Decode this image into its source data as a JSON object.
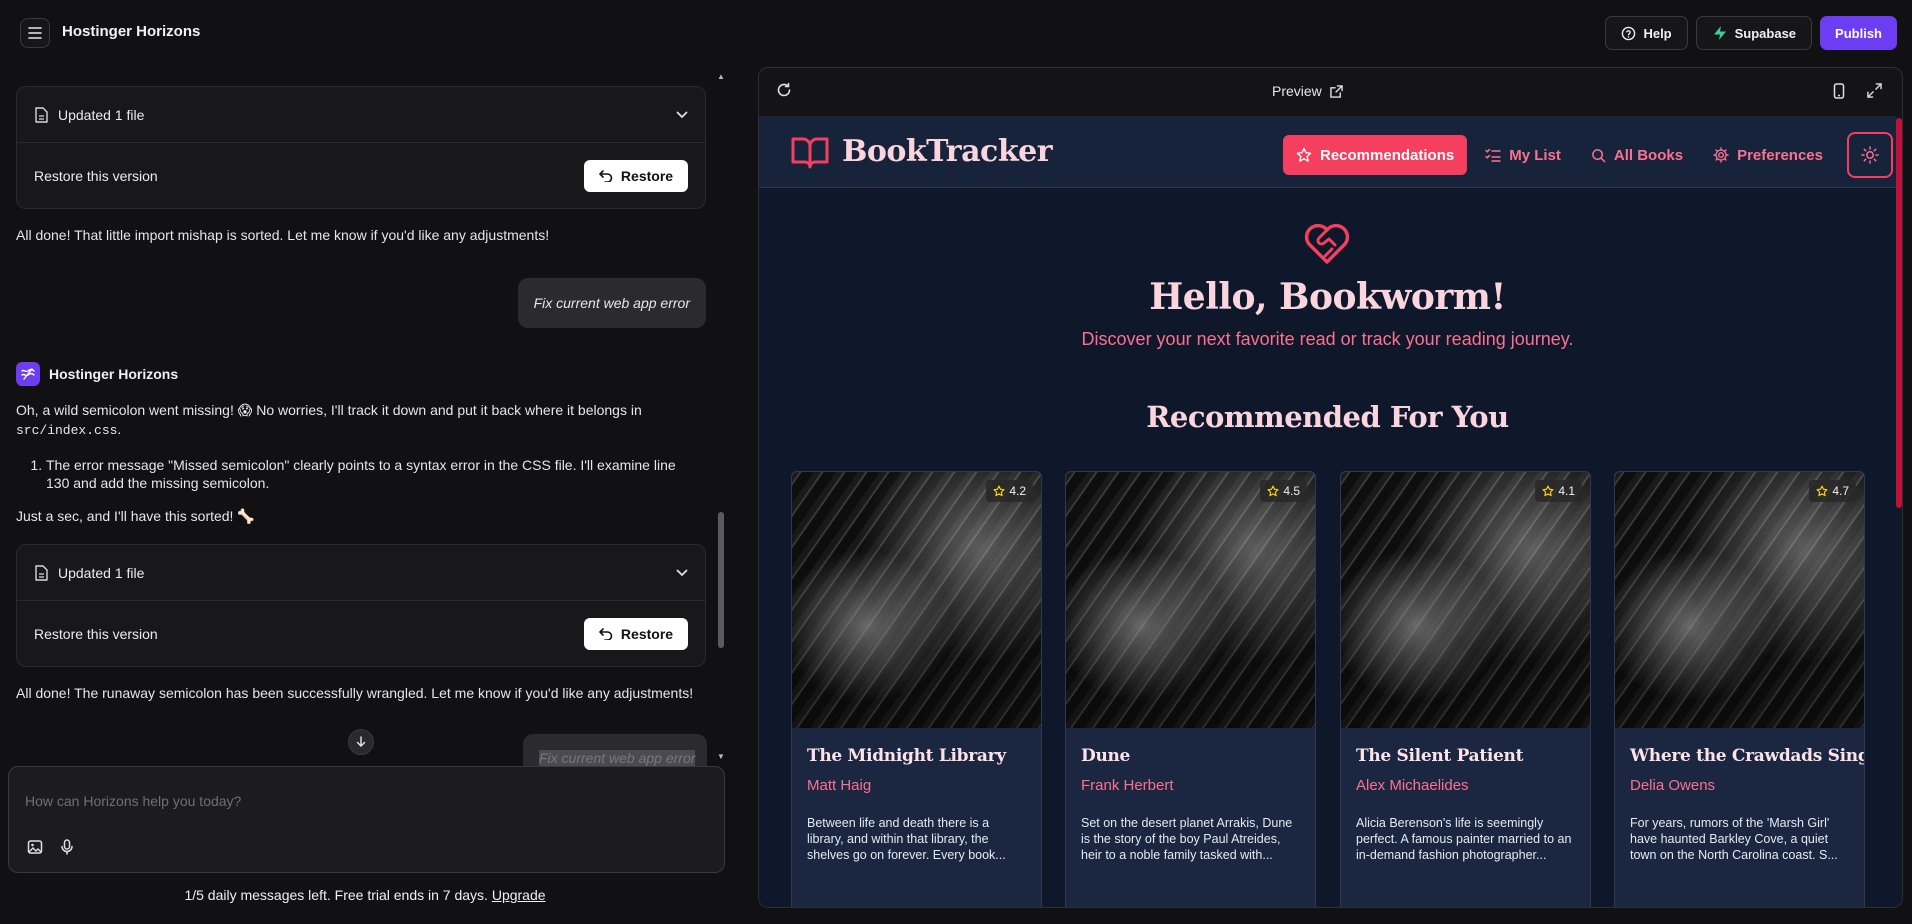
{
  "app": {
    "title": "Hostinger Horizons"
  },
  "top_actions": {
    "help": "Help",
    "supabase": "Supabase",
    "publish": "Publish"
  },
  "chat": {
    "file_card_1": {
      "label": "Updated 1 file",
      "restore_text": "Restore this version",
      "restore_button": "Restore"
    },
    "msg_1": "All done! That little import mishap is sorted. Let me know if you'd like any adjustments!",
    "user_msg_1": "Fix current web app error",
    "agent_name": "Hostinger Horizons",
    "agent_msg_intro": "Oh, a wild semicolon went missing! 😱 No worries, I'll track it down and put it back where it belongs in",
    "agent_msg_file": "src/index.css",
    "agent_msg_period": ".",
    "agent_step_1": "The error message \"Missed semicolon\" clearly points to a syntax error in the CSS file. I'll examine line 130 and add the missing semicolon.",
    "agent_msg_wait": "Just a sec, and I'll have this sorted! 🦴",
    "file_card_2": {
      "label": "Updated 1 file",
      "restore_text": "Restore this version",
      "restore_button": "Restore"
    },
    "msg_2": "All done! The runaway semicolon has been successfully wrangled. Let me know if you'd like any adjustments!",
    "user_msg_2": "Fix current web app error"
  },
  "input": {
    "placeholder": "How can Horizons help you today?"
  },
  "trial": {
    "text": "1/5 daily messages left. Free trial ends in 7 days.",
    "link": "Upgrade"
  },
  "preview": {
    "title": "Preview"
  },
  "site": {
    "brand": "BookTracker",
    "nav": [
      {
        "label": "Recommendations",
        "icon": "star-icon",
        "active": true
      },
      {
        "label": "My List",
        "icon": "list-check-icon"
      },
      {
        "label": "All Books",
        "icon": "search-icon"
      },
      {
        "label": "Preferences",
        "icon": "gear-icon"
      }
    ],
    "hero_title": "Hello, Bookworm!",
    "hero_subtitle": "Discover your next favorite read or track your reading journey.",
    "section_title": "Recommended For You",
    "books": [
      {
        "rating": "4.2",
        "title": "The Midnight Library",
        "author": "Matt Haig",
        "description": "Between life and death there is a library, and within that library, the shelves go on forever. Every book..."
      },
      {
        "rating": "4.5",
        "title": "Dune",
        "author": "Frank Herbert",
        "description": "Set on the desert planet Arrakis, Dune is the story of the boy Paul Atreides, heir to a noble family tasked with..."
      },
      {
        "rating": "4.1",
        "title": "The Silent Patient",
        "author": "Alex Michaelides",
        "description": "Alicia Berenson's life is seemingly perfect. A famous painter married to an in-demand fashion photographer..."
      },
      {
        "rating": "4.7",
        "title": "Where the Crawdads Sing",
        "author": "Delia Owens",
        "description": "For years, rumors of the 'Marsh Girl' have haunted Barkley Cove, a quiet town on the North Carolina coast. S..."
      }
    ]
  },
  "colors": {
    "accent_purple": "#6d3df2",
    "site_accent": "#f43f5e",
    "site_bg": "#0f172a"
  }
}
